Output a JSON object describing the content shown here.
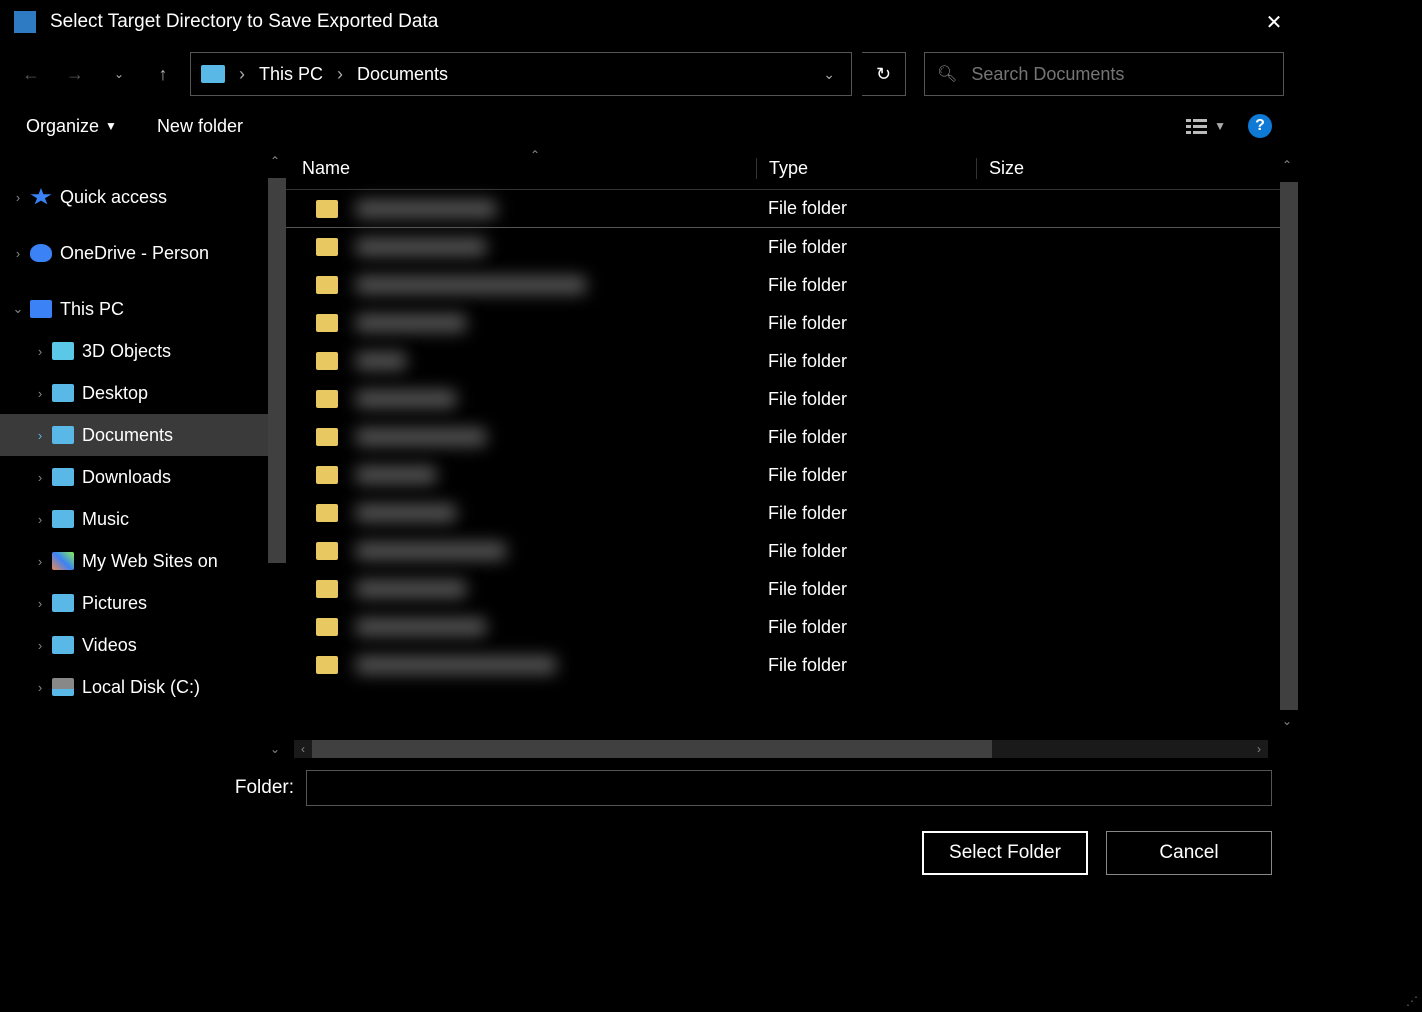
{
  "title": "Select Target Directory to Save Exported Data",
  "breadcrumb": {
    "parts": [
      "This PC",
      "Documents"
    ]
  },
  "search": {
    "placeholder": "Search Documents"
  },
  "toolbar": {
    "organize": "Organize",
    "newfolder": "New folder"
  },
  "tree": [
    {
      "label": "Quick access",
      "iconClass": "star-icon",
      "indent": 0,
      "chevron": "›"
    },
    {
      "label": "OneDrive - Person",
      "iconClass": "cloud-icon",
      "indent": 0,
      "chevron": "›"
    },
    {
      "label": "This PC",
      "iconClass": "pc-icon",
      "indent": 0,
      "chevron": "v",
      "expanded": true
    },
    {
      "label": "3D Objects",
      "iconClass": "cube-icon",
      "indent": 1,
      "chevron": "›"
    },
    {
      "label": "Desktop",
      "iconClass": "folder-blue",
      "indent": 1,
      "chevron": "›"
    },
    {
      "label": "Documents",
      "iconClass": "folder-blue",
      "indent": 1,
      "chevron": "›",
      "selected": true
    },
    {
      "label": "Downloads",
      "iconClass": "folder-blue",
      "indent": 1,
      "chevron": "›"
    },
    {
      "label": "Music",
      "iconClass": "folder-blue",
      "indent": 1,
      "chevron": "›"
    },
    {
      "label": "My Web Sites on",
      "iconClass": "multi-icon",
      "indent": 1,
      "chevron": "›"
    },
    {
      "label": "Pictures",
      "iconClass": "folder-blue",
      "indent": 1,
      "chevron": "›"
    },
    {
      "label": "Videos",
      "iconClass": "folder-blue",
      "indent": 1,
      "chevron": "›"
    },
    {
      "label": "Local Disk (C:)",
      "iconClass": "disk-icon",
      "indent": 1,
      "chevron": "›"
    }
  ],
  "list": {
    "columns": {
      "name": "Name",
      "type": "Type",
      "size": "Size"
    },
    "rows": [
      {
        "nameWidth": 140,
        "type": "File folder"
      },
      {
        "nameWidth": 130,
        "type": "File folder"
      },
      {
        "nameWidth": 230,
        "type": "File folder"
      },
      {
        "nameWidth": 110,
        "type": "File folder"
      },
      {
        "nameWidth": 50,
        "type": "File folder"
      },
      {
        "nameWidth": 100,
        "type": "File folder"
      },
      {
        "nameWidth": 130,
        "type": "File folder"
      },
      {
        "nameWidth": 80,
        "type": "File folder"
      },
      {
        "nameWidth": 100,
        "type": "File folder"
      },
      {
        "nameWidth": 150,
        "type": "File folder"
      },
      {
        "nameWidth": 110,
        "type": "File folder"
      },
      {
        "nameWidth": 130,
        "type": "File folder"
      },
      {
        "nameWidth": 200,
        "type": "File folder"
      }
    ]
  },
  "folderField": {
    "label": "Folder:",
    "value": ""
  },
  "buttons": {
    "select": "Select Folder",
    "cancel": "Cancel"
  }
}
